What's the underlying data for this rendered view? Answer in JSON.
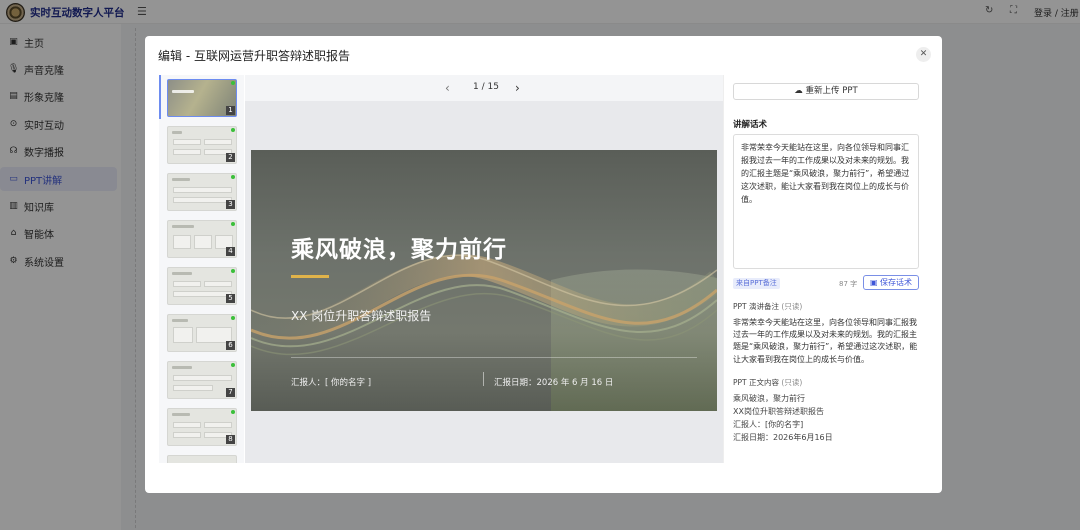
{
  "app": {
    "brand": "实时互动数字人平台",
    "menu_icon": "☰",
    "login": "登录 / 注册"
  },
  "sidebar": {
    "items": [
      {
        "label": "主页",
        "icon": "monitor-icon"
      },
      {
        "label": "声音克隆",
        "icon": "microphone-icon"
      },
      {
        "label": "形象克隆",
        "icon": "image-icon"
      },
      {
        "label": "实时互动",
        "icon": "play-circle-icon"
      },
      {
        "label": "数字播报",
        "icon": "broadcast-icon"
      },
      {
        "label": "PPT讲解",
        "icon": "ppt-icon",
        "active": true
      },
      {
        "label": "知识库",
        "icon": "book-icon"
      },
      {
        "label": "智能体",
        "icon": "robot-icon"
      },
      {
        "label": "系统设置",
        "icon": "gear-icon"
      }
    ]
  },
  "modal": {
    "title": "编辑 - 互联网运营升职答辩述职报告",
    "close": "✕"
  },
  "thumbnails": {
    "numbers": [
      "1",
      "2",
      "3",
      "4",
      "5",
      "6",
      "7",
      "8"
    ],
    "selected": 1
  },
  "pager": {
    "text": "1 / 15"
  },
  "slide": {
    "title": "乘风破浪，聚力前行",
    "subtitle": "XX 岗位升职答辩述职报告",
    "reporter": "汇报人：[ 你的名字 ]",
    "date": "汇报日期：2026 年 6 月 16 日"
  },
  "panel": {
    "reupload_label": "重新上传 PPT",
    "script_label": "讲解话术",
    "script_text": "非常荣幸今天能站在这里，向各位领导和同事汇报我过去一年的工作成果以及对未来的规划。我的汇报主题是“乘风破浪，聚力前行”，希望通过这次述职，能让大家看到我在岗位上的成长与价值。",
    "source_tag": "来自PPT备注",
    "char_count": "87 字",
    "save_label": "保存话术",
    "notes_label": "PPT 演讲备注",
    "readonly": "(只读)",
    "notes_text": "非常荣幸今天能站在这里，向各位领导和同事汇报我过去一年的工作成果以及对未来的规划。我的汇报主题是“乘风破浪，聚力前行”，希望通过这次述职，能让大家看到我在岗位上的成长与价值。",
    "content_label": "PPT 正文内容",
    "content_lines": [
      "乘风破浪，聚力前行",
      "XX岗位升职答辩述职报告",
      "汇报人：[你的名字]",
      "汇报日期：2026年6月16日"
    ]
  }
}
